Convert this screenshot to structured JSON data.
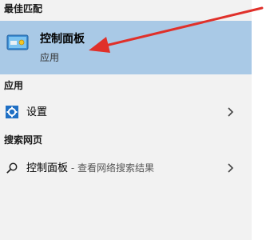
{
  "sections": {
    "best_match": "最佳匹配",
    "apps": "应用",
    "web": "搜索网页"
  },
  "best_match_item": {
    "title": "控制面板",
    "subtitle": "应用",
    "icon": "control-panel-icon"
  },
  "apps_items": [
    {
      "label": "设置",
      "icon": "gear-icon"
    }
  ],
  "web_items": [
    {
      "label": "控制面板",
      "suffix": " - 查看网络搜索结果",
      "icon": "search-icon"
    }
  ],
  "colors": {
    "background": "#f2f2f2",
    "selected": "#a9c9e6",
    "arrow": "#e0302a",
    "accent": "#1f6fc4"
  }
}
